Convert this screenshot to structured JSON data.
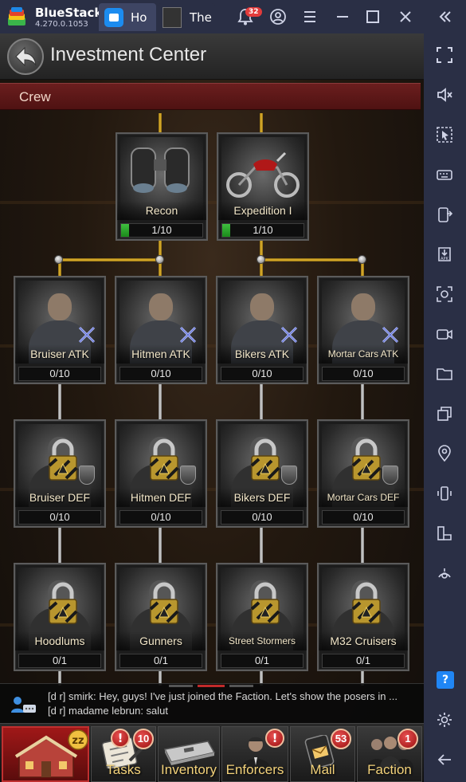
{
  "window": {
    "app_name": "BlueStacks",
    "version": "4.270.0.1053",
    "tabs": [
      {
        "label": "Ho",
        "icon": "home-icon"
      },
      {
        "label": "The",
        "icon": "game-thumbnail-icon"
      }
    ],
    "notification_count": "32"
  },
  "header": {
    "title": "Investment Center"
  },
  "section": {
    "label": "Crew"
  },
  "cards": [
    {
      "name": "Recon",
      "progress": "1/10",
      "fill": 0.1,
      "locked": false
    },
    {
      "name": "Expedition I",
      "progress": "1/10",
      "fill": 0.1,
      "locked": false
    },
    {
      "name": "Bruiser ATK",
      "progress": "0/10",
      "fill": 0,
      "locked": false
    },
    {
      "name": "Hitmen ATK",
      "progress": "0/10",
      "fill": 0,
      "locked": false
    },
    {
      "name": "Bikers ATK",
      "progress": "0/10",
      "fill": 0,
      "locked": false
    },
    {
      "name": "Mortar Cars ATK",
      "progress": "0/10",
      "fill": 0,
      "locked": false
    },
    {
      "name": "Bruiser DEF",
      "progress": "0/10",
      "fill": 0,
      "locked": true
    },
    {
      "name": "Hitmen DEF",
      "progress": "0/10",
      "fill": 0,
      "locked": true
    },
    {
      "name": "Bikers DEF",
      "progress": "0/10",
      "fill": 0,
      "locked": true
    },
    {
      "name": "Mortar Cars DEF",
      "progress": "0/10",
      "fill": 0,
      "locked": true
    },
    {
      "name": "Hoodlums",
      "progress": "0/1",
      "fill": 0,
      "locked": true
    },
    {
      "name": "Gunners",
      "progress": "0/1",
      "fill": 0,
      "locked": true
    },
    {
      "name": "Street Stormers",
      "progress": "0/1",
      "fill": 0,
      "locked": true
    },
    {
      "name": "M32 Cruisers",
      "progress": "0/1",
      "fill": 0,
      "locked": true
    }
  ],
  "chat": {
    "lines": [
      "[d r] smirk: Hey, guys! I've just joined the Faction. Let's show the posers in ...",
      "[d r] madame lebrun: salut"
    ]
  },
  "bottom_nav": {
    "items": [
      {
        "label": "",
        "badge": "zz"
      },
      {
        "label": "Tasks",
        "badge": "10",
        "alert": "!"
      },
      {
        "label": "Inventory",
        "badge": ""
      },
      {
        "label": "Enforcers",
        "badge": "",
        "alert": "!"
      },
      {
        "label": "Mail",
        "badge": "53"
      },
      {
        "label": "Faction",
        "badge": "1"
      }
    ]
  },
  "sidebar": {
    "icons": [
      "fullscreen-icon",
      "volume-mute-icon",
      "cursor-icon",
      "keyboard-icon",
      "phone-transfer-icon",
      "apk-icon",
      "screenshot-icon",
      "record-icon",
      "folder-icon",
      "multi-instance-icon",
      "location-icon",
      "shake-icon",
      "rotate-icon",
      "gamepad-icon",
      "help-icon",
      "settings-icon",
      "back-icon"
    ],
    "help_label": "?"
  },
  "colors": {
    "accent": "#2086f5",
    "crew_bar": "#5c1818",
    "gold_text": "#f3d27a",
    "progress_fill": "#2fa52f"
  }
}
